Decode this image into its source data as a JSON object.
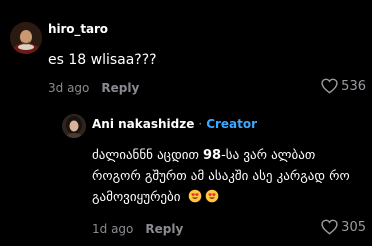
{
  "comment": {
    "username": "hiro_taro",
    "text": "es 18 wlisaa???",
    "time": "3d ago",
    "reply_label": "Reply",
    "likes": "536"
  },
  "reply": {
    "username": "Ani nakashidze",
    "separator": "·",
    "badge": "Creator",
    "text_before_bold": "ძალიანნნ აცდით ",
    "text_bold": "98",
    "text_after_bold": "-სა ვარ ალბათ როგორ გშურთ ამ ასაკში ასე კარგად რო გამოვიყურები",
    "emojis": [
      "smiling-face-with-heart-eyes",
      "smiling-face-with-heart-eyes"
    ],
    "time": "1d ago",
    "reply_label": "Reply",
    "likes": "305"
  },
  "colors": {
    "background": "#000000",
    "muted": "#8a8b91",
    "creator_badge": "#3da8ff"
  }
}
